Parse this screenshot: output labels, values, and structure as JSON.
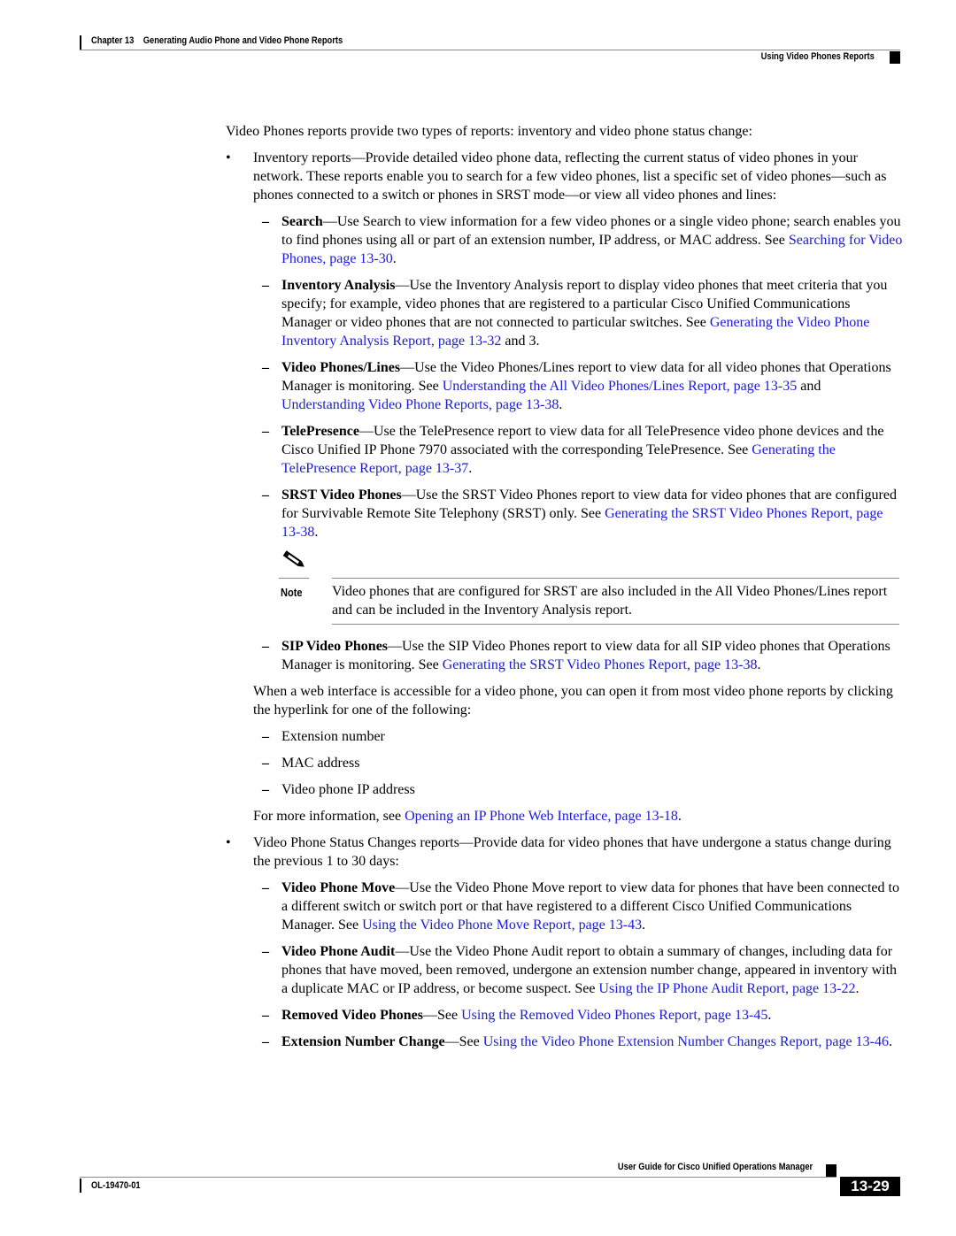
{
  "header": {
    "chapter": "Chapter 13",
    "chapter_title": "Generating Audio Phone and Video Phone Reports",
    "section": "Using Video Phones Reports"
  },
  "intro": "Video Phones reports provide two types of reports: inventory and video phone status change:",
  "inventory": {
    "bullet": "•",
    "text": "Inventory reports—Provide detailed video phone data, reflecting the current status of video phones in your network. These reports enable you to search for a few video phones, list a specific set of video phones—such as phones connected to a switch or phones in SRST mode—or view all video phones and lines:",
    "items": [
      {
        "term": "Search",
        "text": "—Use Search to view information for a few video phones or a single video phone; search enables you to find phones using all or part of an extension number, IP address, or MAC address. See ",
        "link": "Searching for Video Phones, page 13-30",
        "tail": "."
      },
      {
        "term": "Inventory Analysis",
        "text": "—Use the Inventory Analysis report to display video phones that meet criteria that you specify; for example, video phones that are registered to a particular Cisco Unified Communications Manager or video phones that are not connected to particular switches. See ",
        "link": "Generating the Video Phone Inventory Analysis Report, page 13-32",
        "tail": " and 3."
      },
      {
        "term": "Video Phones/Lines",
        "text": "—Use the Video Phones/Lines report to view data for all video phones that Operations Manager is monitoring. See ",
        "link": "Understanding the All Video Phones/Lines Report, page 13-35",
        "mid": " and ",
        "link2": "Understanding Video Phone Reports, page 13-38",
        "tail": "."
      },
      {
        "term": "TelePresence",
        "text": "—Use the TelePresence report to view data for all TelePresence video phone devices and the Cisco Unified IP Phone 7970 associated with the corresponding TelePresence. See ",
        "link": "Generating the TelePresence Report, page 13-37",
        "tail": "."
      },
      {
        "term": "SRST Video Phones",
        "text": "—Use the SRST Video Phones report to view data for video phones that are configured for Survivable Remote Site Telephony (SRST) only. See ",
        "link": "Generating the SRST Video Phones Report, page 13-38",
        "tail": "."
      }
    ],
    "note": {
      "label": "Note",
      "text": "Video phones that are configured for SRST are also included in the All Video Phones/Lines report and can be included in the Inventory Analysis report."
    },
    "sip": {
      "term": "SIP Video Phones",
      "text": "—Use the SIP Video Phones report to view data for all SIP video phones that Operations Manager is monitoring. See ",
      "link": "Generating the SRST Video Phones Report, page 13-38",
      "tail": "."
    },
    "web_para": "When a web interface is accessible for a video phone, you can open it from most video phone reports by clicking the hyperlink for one of the following:",
    "web_items": [
      "Extension number",
      "MAC address",
      "Video phone IP address"
    ],
    "more_info": {
      "text": "For more information, see ",
      "link": "Opening an IP Phone Web Interface, page 13-18",
      "tail": "."
    }
  },
  "status": {
    "bullet": "•",
    "text": "Video Phone Status Changes reports—Provide data for video phones that have undergone a status change during the previous 1 to 30 days:",
    "items": [
      {
        "term": "Video Phone Move",
        "text": "—Use the Video Phone Move report to view data for phones that have been connected to a different switch or switch port or that have registered to a different Cisco Unified Communications Manager. See ",
        "link": "Using the Video Phone Move Report, page 13-43",
        "tail": "."
      },
      {
        "term": "Video Phone Audit",
        "text": "—Use the Video Phone Audit report to obtain a summary of changes, including data for phones that have moved, been removed, undergone an extension number change, appeared in inventory with a duplicate MAC or IP address, or become suspect. See ",
        "link": "Using the IP Phone Audit Report, page 13-22",
        "tail": "."
      },
      {
        "term": "Removed Video Phones",
        "text": "—See ",
        "link": "Using the Removed Video Phones Report, page 13-45",
        "tail": "."
      },
      {
        "term": "Extension Number Change",
        "text": "—See ",
        "link": "Using the Video Phone Extension Number Changes Report, page 13-46",
        "tail": "."
      }
    ]
  },
  "dash": "–",
  "footer": {
    "guide_title": "User Guide for Cisco Unified Operations Manager",
    "doc_number": "OL-19470-01",
    "page_number": "13-29"
  },
  "colors": {
    "link": "#1a1adb",
    "text": "#000000",
    "rule": "#8a8a8a"
  }
}
